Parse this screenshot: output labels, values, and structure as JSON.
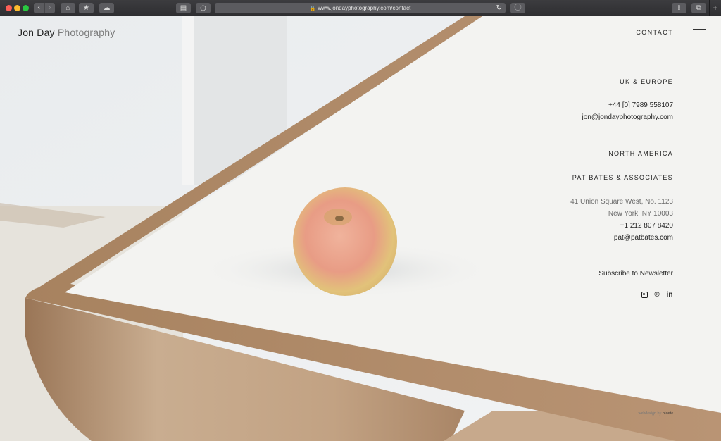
{
  "browser": {
    "url": "www.jondayphotography.com/contact",
    "buttons": {
      "back": "‹",
      "forward": "›",
      "home": "⌂",
      "bookmarks": "★",
      "cloud": "☁",
      "sidebar": "▤",
      "history": "◷",
      "info": "ⓘ",
      "share": "⇪",
      "tabs": "⧉",
      "reload": "↻",
      "lock": "🔒",
      "new_tab": "+"
    }
  },
  "site": {
    "logo_first": "Jon Day",
    "logo_second": "Photography",
    "nav_contact": "CONTACT"
  },
  "uk": {
    "heading": "UK & EUROPE",
    "phone": "+44 [0] 7989 558107",
    "email": "jon@jondayphotography.com"
  },
  "na": {
    "heading": "NORTH AMERICA",
    "agency": "PAT BATES & ASSOCIATES",
    "address_line1": "41 Union Square West, No. 1123",
    "address_line2": "New York, NY 10003",
    "phone": "+1 212 807 8420",
    "email": "pat@patbates.com"
  },
  "newsletter": "Subscribe to Newsletter",
  "social_icons": [
    "instagram-icon",
    "pinterest-icon",
    "linkedin-icon"
  ],
  "social_glyphs": {
    "pinterest": "℗",
    "linkedin": "in"
  },
  "credit": {
    "prefix": "webdesign by ",
    "name": "nioute"
  },
  "colors": {
    "chrome": "#333336",
    "text": "#1f1f1f",
    "wood": "#b08c6a",
    "table_top": "#f3f3f1"
  }
}
